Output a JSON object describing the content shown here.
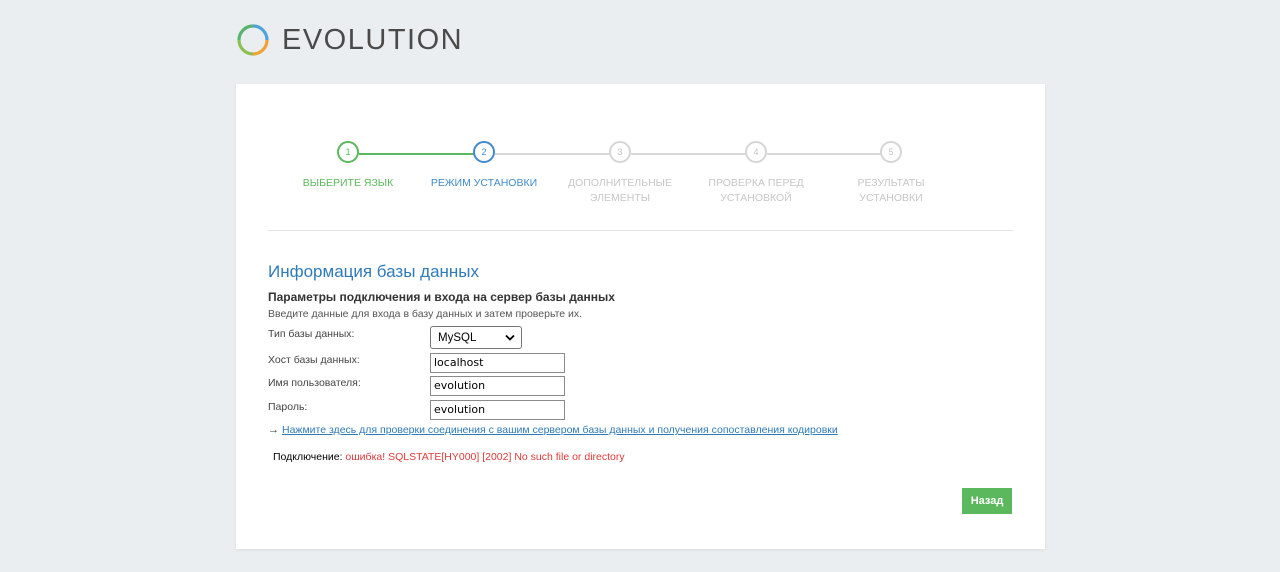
{
  "brand": {
    "name": "EVOLUTION"
  },
  "steps": [
    {
      "number": "1",
      "label": "ВЫБЕРИТЕ ЯЗЫК",
      "state": "done"
    },
    {
      "number": "2",
      "label": "РЕЖИМ УСТАНОВКИ",
      "state": "active"
    },
    {
      "number": "3",
      "label": "ДОПОЛНИТЕЛЬНЫЕ ЭЛЕМЕНТЫ",
      "state": "pending"
    },
    {
      "number": "4",
      "label": "ПРОВЕРКА ПЕРЕД УСТАНОВКОЙ",
      "state": "pending"
    },
    {
      "number": "5",
      "label": "РЕЗУЛЬТАТЫ УСТАНОВКИ",
      "state": "pending"
    }
  ],
  "section": {
    "title": "Информация базы данных",
    "subtitle": "Параметры подключения и входа на сервер базы данных",
    "hint": "Введите данные для входа в базу данных и затем проверьте их."
  },
  "form": {
    "db_type_label": "Тип базы данных:",
    "db_type_value": "MySQL",
    "db_host_label": "Хост базы данных:",
    "db_host_value": "localhost",
    "db_user_label": "Имя пользователя:",
    "db_user_value": "evolution",
    "db_password_label": "Пароль:",
    "db_password_value": "evolution"
  },
  "check_link": {
    "arrow": "→",
    "text": "Нажмите здесь для проверки соединения с вашим сервером базы данных и получения сопоставления кодировки"
  },
  "connection": {
    "label": "Подключение: ",
    "error": "ошибка! SQLSTATE[HY000] [2002] No such file or directory"
  },
  "back_button": "Назад",
  "colors": {
    "done": "#5cb85c",
    "active": "#428bca",
    "pending": "#d6d6d6",
    "error": "#e03a3a",
    "background": "#ebeef0"
  }
}
